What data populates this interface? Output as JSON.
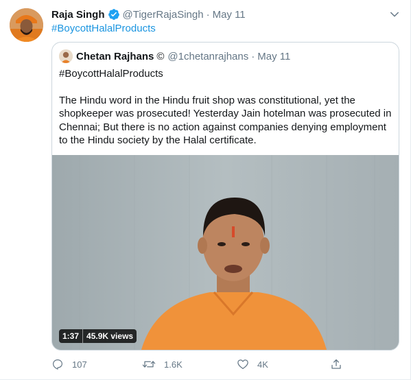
{
  "tweet": {
    "author_name": "Raja Singh",
    "handle": "@TigerRajaSingh",
    "separator": "·",
    "date": "May 11",
    "text": "#BoycottHalalProducts",
    "accent_color": "#1b95e0"
  },
  "quote": {
    "author_name": "Chetan Rajhans",
    "name_glyph": "©",
    "handle": "@1chetanrajhans",
    "separator": "·",
    "date": "May 11",
    "hashtag_line": "#BoycottHalalProducts",
    "paragraph": "The Hindu word in the Hindu fruit shop was constitutional, yet the shopkeeper was prosecuted! Yesterday Jain hotelman was prosecuted in Chennai; But there is no action against companies denying employment to the Hindu society by the Halal certificate.",
    "video": {
      "duration": "1:37",
      "views": "45.9K views"
    }
  },
  "actions": {
    "reply_count": "107",
    "retweet_count": "1.6K",
    "like_count": "4K"
  },
  "icons": {
    "verified": "verified-badge-icon",
    "caret": "chevron-down-icon",
    "reply": "reply-icon",
    "retweet": "retweet-icon",
    "like": "heart-icon",
    "share": "share-icon"
  }
}
